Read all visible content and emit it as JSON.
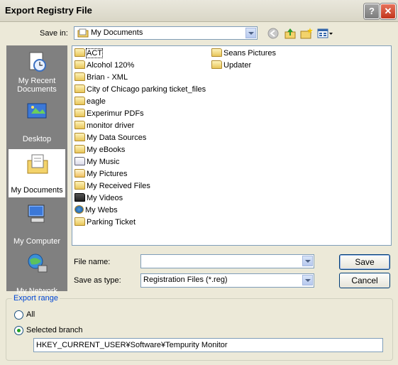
{
  "window": {
    "title": "Export Registry File",
    "help_symbol": "?",
    "close_symbol": "✕"
  },
  "save_in": {
    "label": "Save in:",
    "value": "My Documents"
  },
  "toolbar_icons": [
    "back-arrow-icon",
    "up-folder-icon",
    "new-folder-icon",
    "views-menu-icon"
  ],
  "places": [
    {
      "label": "My Recent Documents",
      "icon": "recent-documents-icon"
    },
    {
      "label": "Desktop",
      "icon": "desktop-icon"
    },
    {
      "label": "My Documents",
      "icon": "my-documents-icon",
      "selected": true
    },
    {
      "label": "My Computer",
      "icon": "my-computer-icon"
    },
    {
      "label": "My Network",
      "icon": "my-network-icon"
    }
  ],
  "files_col1": [
    "ACT",
    "Alcohol 120%",
    "Brian - XML",
    "City of Chicago parking ticket_files",
    "eagle",
    "Experimur PDFs",
    "monitor driver",
    "My Data Sources",
    "My eBooks",
    "My Music",
    "My Pictures",
    "My Received Files",
    "My Videos",
    "My Webs",
    "Parking Ticket"
  ],
  "files_col2": [
    "Seans Pictures",
    "Updater"
  ],
  "file_name": {
    "label": "File name:",
    "value": ""
  },
  "save_as_type": {
    "label": "Save as type:",
    "value": "Registration Files (*.reg)"
  },
  "buttons": {
    "save": "Save",
    "cancel": "Cancel"
  },
  "export_range": {
    "legend": "Export range",
    "all_label": "All",
    "selected_label": "Selected branch",
    "selected": "branch",
    "branch_value": "HKEY_CURRENT_USER¥Software¥Tempurity Monitor"
  }
}
